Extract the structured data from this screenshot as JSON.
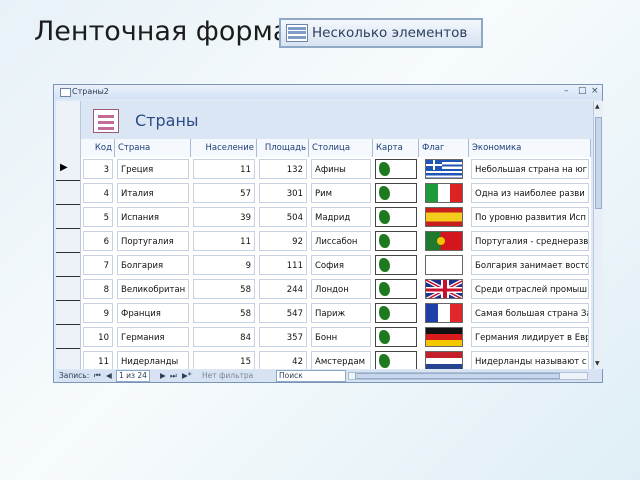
{
  "slide": {
    "title": "Ленточная форма"
  },
  "multi_items_button": {
    "label": "Несколько элементов",
    "icon": "multiple-items-icon"
  },
  "window": {
    "title": "Страны2",
    "controls": [
      "–",
      "□",
      "×"
    ]
  },
  "form": {
    "title": "Страны",
    "icon": "form-icon"
  },
  "columns": [
    "Код",
    "Страна",
    "Население",
    "Площадь",
    "Столица",
    "Карта",
    "Флаг",
    "Экономика"
  ],
  "rows": [
    {
      "code": "3",
      "country": "Греция",
      "population": "11",
      "area": "132",
      "capital": "Афины",
      "flag": "greece",
      "economy": "Небольшая страна на юг"
    },
    {
      "code": "4",
      "country": "Италия",
      "population": "57",
      "area": "301",
      "capital": "Рим",
      "flag": "italy",
      "economy": "Одна из наиболее разви"
    },
    {
      "code": "5",
      "country": "Испания",
      "population": "39",
      "area": "504",
      "capital": "Мадрид",
      "flag": "spain",
      "economy": "По уровню развития Исп"
    },
    {
      "code": "6",
      "country": "Португалия",
      "population": "11",
      "area": "92",
      "capital": "Лиссабон",
      "flag": "portugal",
      "economy": "Португалия - среднеразв"
    },
    {
      "code": "7",
      "country": "Болгария",
      "population": "9",
      "area": "111",
      "capital": "София",
      "flag": "",
      "economy": "Болгария занимает восто"
    },
    {
      "code": "8",
      "country": "Великобритан",
      "population": "58",
      "area": "244",
      "capital": "Лондон",
      "flag": "uk",
      "economy": "Среди отраслей промыш"
    },
    {
      "code": "9",
      "country": "Франция",
      "population": "58",
      "area": "547",
      "capital": "Париж",
      "flag": "france",
      "economy": "Самая большая страна За"
    },
    {
      "code": "10",
      "country": "Германия",
      "population": "84",
      "area": "357",
      "capital": "Бонн",
      "flag": "germany",
      "economy": "Германия лидирует в Евр"
    },
    {
      "code": "11",
      "country": "Нидерланды",
      "population": "15",
      "area": "42",
      "capital": "Амстердам",
      "flag": "netherlands",
      "economy": "Нидерланды называют с"
    }
  ],
  "statusbar": {
    "record_label": "Запись:",
    "position": "1 из 24",
    "filter": "Нет фильтра",
    "search": "Поиск",
    "nav_first": "⏮",
    "nav_prev": "◀",
    "nav_next": "▶",
    "nav_last": "⏭",
    "nav_new": "▶*"
  }
}
